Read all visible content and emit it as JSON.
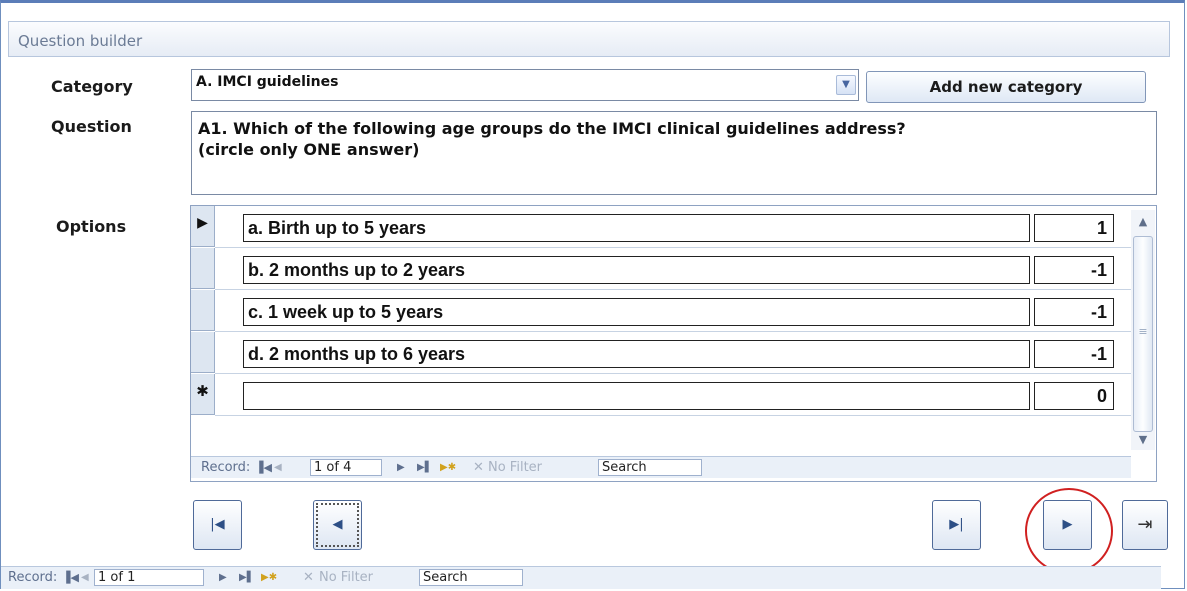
{
  "window": {
    "title": "Question builder"
  },
  "labels": {
    "category": "Category",
    "question": "Question",
    "options": "Options"
  },
  "category": {
    "value": "A. IMCI guidelines",
    "add_button": "Add new category"
  },
  "question": {
    "line1": "A1. Which of the following age groups do the IMCI clinical guidelines address?",
    "line2": "(circle only ONE answer)"
  },
  "options": [
    {
      "text": "a. Birth up to 5 years",
      "score": "1",
      "selector": "▶"
    },
    {
      "text": "b. 2 months up to 2 years",
      "score": "-1",
      "selector": ""
    },
    {
      "text": "c. 1 week up to 5 years",
      "score": "-1",
      "selector": ""
    },
    {
      "text": "d. 2 months up to 6 years",
      "score": "-1",
      "selector": ""
    },
    {
      "text": "",
      "score": "0",
      "selector": "✱"
    }
  ],
  "subform_nav": {
    "label": "Record:",
    "position": "1 of 4",
    "filter": "No Filter",
    "search": "Search"
  },
  "main_nav": {
    "label": "Record:",
    "position": "1 of 1",
    "filter": "No Filter",
    "search": "Search"
  },
  "icons": {
    "first": "|◀",
    "prev": "◀",
    "next": "▶",
    "last": "▶|",
    "new": "▶✱",
    "nav_first": "▐◀",
    "nav_prev": "◀",
    "nav_next": "▶",
    "nav_last": "▶▌",
    "exit": "⇥"
  },
  "colors": {
    "highlight_circle": "#d02020",
    "frame": "#5b7db8"
  }
}
